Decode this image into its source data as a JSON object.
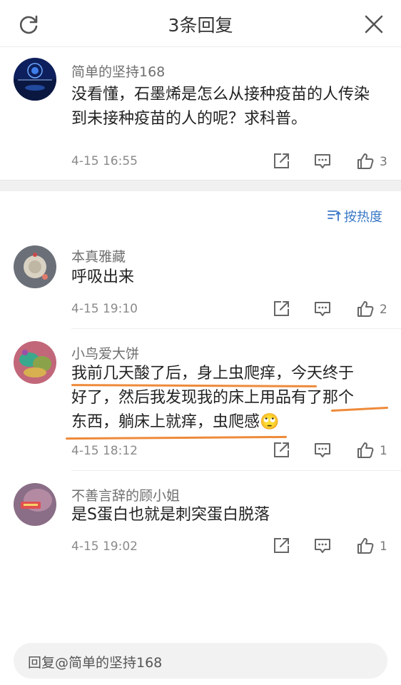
{
  "header": {
    "title": "3条回复",
    "refresh_icon": "refresh-icon",
    "close_icon": "close-icon"
  },
  "main_comment": {
    "username": "简单的坚持168",
    "text_line1": "没看懂，石墨烯是怎么从接种疫苗的人传染",
    "text_line2": "到未接种疫苗的人的呢？求科普。",
    "time": "4-15 16:55",
    "likes": "3"
  },
  "sort": {
    "label": "按热度",
    "icon": "sort-icon"
  },
  "replies": [
    {
      "username": "本真雅藏",
      "lines": [
        "呼吸出来"
      ],
      "time": "4-15 19:10",
      "likes": "2"
    },
    {
      "username": "小鸟爱大饼",
      "lines": [
        "我前几天酸了后，身上虫爬痒，今天终于",
        "好了，然后我发现我的床上用品有了那个",
        "东西，躺床上就痒，虫爬感🙄"
      ],
      "time": "4-15 18:12",
      "likes": "1"
    },
    {
      "username": "不善言辞的顾小姐",
      "lines": [
        "是S蛋白也就是刺突蛋白脱落"
      ],
      "time": "4-15 19:02",
      "likes": "1"
    }
  ],
  "reply_input": {
    "placeholder": "回复@简单的坚持168"
  },
  "colors": {
    "accent": "#3a78c6",
    "underline": "#ee8a3a",
    "divider": "#f0f0f0"
  }
}
